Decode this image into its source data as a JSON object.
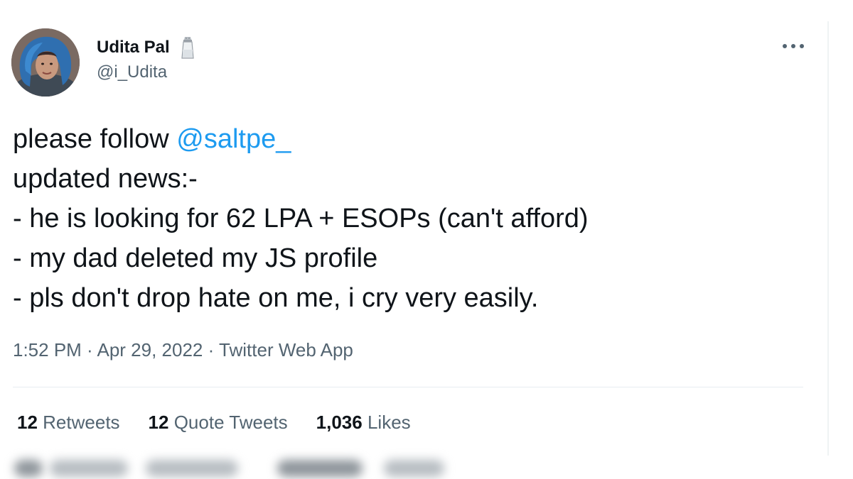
{
  "tweet": {
    "author": {
      "display_name": "Udita Pal",
      "handle": "@i_Udita",
      "badge_icon": "salt-shaker-icon"
    },
    "more_icon": "more-options-icon",
    "text": {
      "line1_prefix": "please follow ",
      "mention": "@saltpe_",
      "line2": "updated news:-",
      "line3": "- he is looking for 62 LPA + ESOPs (can't afford)",
      "line4": "- my dad deleted my JS profile",
      "line5": "- pls don't drop hate on me, i cry very easily."
    },
    "meta": {
      "time": "1:52 PM",
      "separator1": " · ",
      "date": "Apr 29, 2022",
      "separator2": " · ",
      "source": "Twitter Web App"
    },
    "stats": {
      "retweets_count": "12",
      "retweets_label": "Retweets",
      "quotes_count": "12",
      "quotes_label": "Quote Tweets",
      "likes_count": "1,036",
      "likes_label": "Likes"
    },
    "colors": {
      "text": "#0f1419",
      "secondary": "#536471",
      "link": "#1d9bf0",
      "divider": "#e6ecf0"
    }
  }
}
